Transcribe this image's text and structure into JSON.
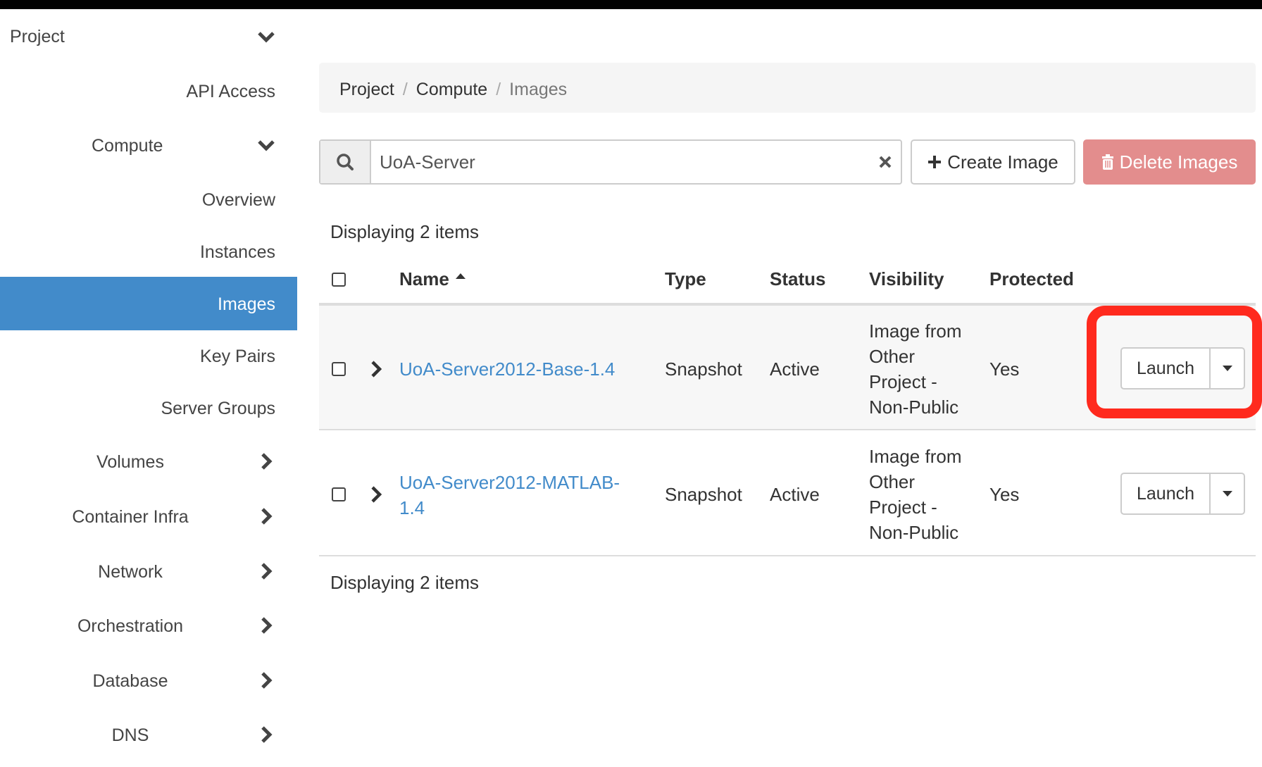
{
  "sidebar": {
    "project": "Project",
    "api_access": "API Access",
    "compute": "Compute",
    "items": [
      "Overview",
      "Instances",
      "Images",
      "Key Pairs",
      "Server Groups"
    ],
    "groups": [
      "Volumes",
      "Container Infra",
      "Network",
      "Orchestration",
      "Database",
      "DNS"
    ],
    "selected": "Images",
    "selected_color": "#428bca"
  },
  "breadcrumb": [
    "Project",
    "Compute",
    "Images"
  ],
  "search": {
    "value": "UoA-Server"
  },
  "toolbar": {
    "create": "Create Image",
    "delete": "Delete Images"
  },
  "table": {
    "count_top": "Displaying 2 items",
    "count_bottom": "Displaying 2 items",
    "headers": [
      "Name",
      "Type",
      "Status",
      "Visibility",
      "Protected"
    ],
    "rows": [
      {
        "name": "UoA-Server2012-Base-1.4",
        "type": "Snapshot",
        "status": "Active",
        "visibility": [
          "Image from",
          "Other",
          "Project -",
          "Non-Public"
        ],
        "protected": "Yes",
        "action": "Launch"
      },
      {
        "name_lines": [
          "UoA-Server2012-MATLAB-",
          "1.4"
        ],
        "type": "Snapshot",
        "status": "Active",
        "visibility": [
          "Image from",
          "Other",
          "Project -",
          "Non-Public"
        ],
        "protected": "Yes",
        "action": "Launch"
      }
    ]
  },
  "highlight_color": "#ff2a1e"
}
